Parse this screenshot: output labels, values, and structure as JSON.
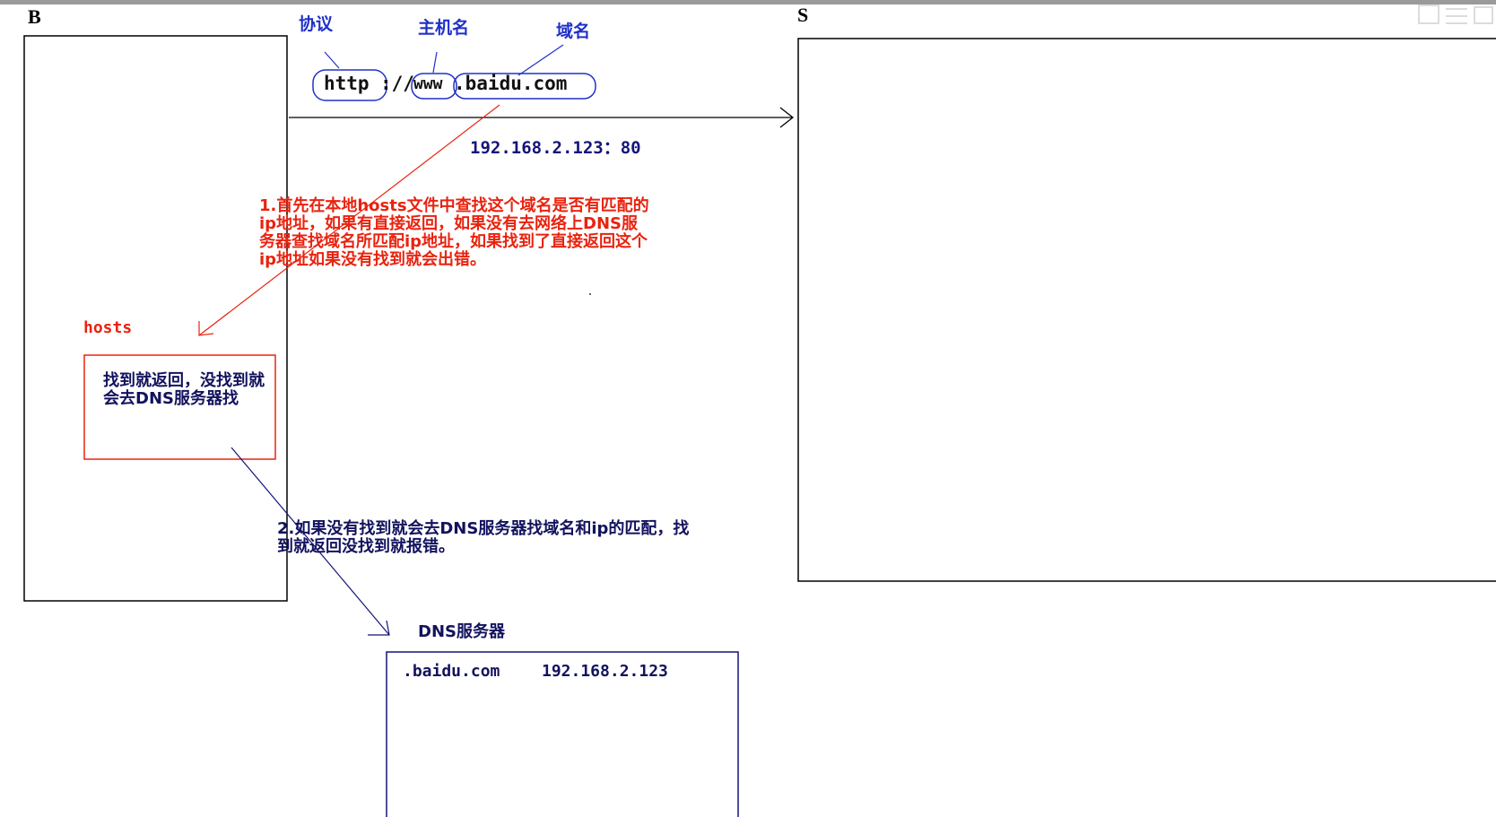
{
  "client_label": "B",
  "server_label": "S",
  "url_parts": {
    "protocol": "http",
    "separator": "://",
    "host": "www",
    "domain": ".baidu.com"
  },
  "tags": {
    "protocol": "协议",
    "hostname": "主机名",
    "domain": "域名"
  },
  "resolved_address": "192.168.2.123：80",
  "note_step1": "1.首先在本地hosts文件中查找这个域名是否有匹配的ip地址，如果有直接返回，如果没有去网络上DNS服务器查找域名所匹配ip地址，如果找到了直接返回这个ip地址如果没有找到就会出错。",
  "hosts_title": "hosts",
  "hosts_box_text": "找到就返回，没找到就会去DNS服务器找",
  "note_step2": "2.如果没有找到就会去DNS服务器找域名和ip的匹配，找到就返回没找到就报错。",
  "dns_title": "DNS服务器",
  "dns_record": {
    "domain": ".baidu.com",
    "ip": "192.168.2.123"
  },
  "colors": {
    "red": "#e8230f",
    "navy": "#14147a",
    "blue": "#2030c8",
    "black": "#000000"
  }
}
